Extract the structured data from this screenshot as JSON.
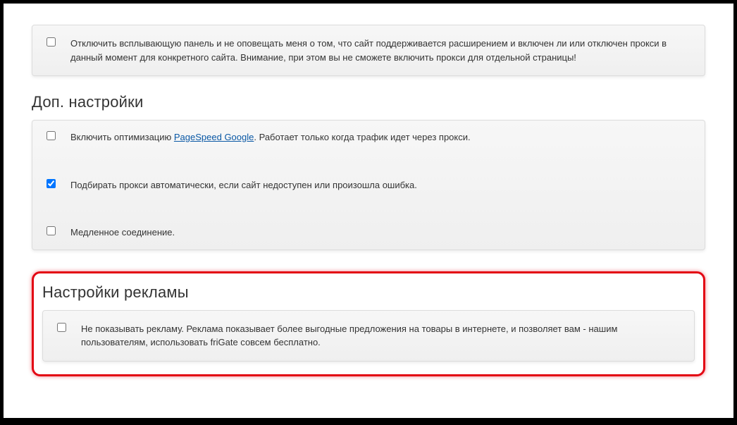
{
  "section1": {
    "items": [
      {
        "checked": false,
        "text": "Отключить всплывающую панель и не оповещать меня о том, что сайт поддерживается расширением и включен ли или отключен прокси в данный момент для конкретного сайта. Внимание, при этом вы не сможете включить прокси для отдельной страницы!"
      }
    ]
  },
  "section2": {
    "heading": "Доп. настройки",
    "items": [
      {
        "checked": false,
        "text_before": "Включить оптимизацию ",
        "link_text": "PageSpeed Google",
        "text_after": ". Работает только когда трафик идет через прокси."
      },
      {
        "checked": true,
        "text": "Подбирать прокси автоматически, если сайт недоступен или произошла ошибка."
      },
      {
        "checked": false,
        "text": "Медленное соединение."
      }
    ]
  },
  "section3": {
    "heading": "Настройки рекламы",
    "items": [
      {
        "checked": false,
        "text": "Не показывать рекламу. Реклама показывает более выгодные предложения на товары в интернете, и позволяет вам - нашим пользователям, использовать friGate совсем бесплатно."
      }
    ]
  }
}
